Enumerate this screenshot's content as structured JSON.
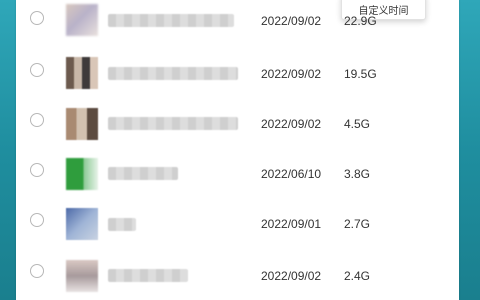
{
  "popup": {
    "label": "自定义时间"
  },
  "rows": [
    {
      "date": "2022/09/02",
      "size": "22.9G"
    },
    {
      "date": "2022/09/02",
      "size": "19.5G"
    },
    {
      "date": "2022/09/02",
      "size": "4.5G"
    },
    {
      "date": "2022/06/10",
      "size": "3.8G"
    },
    {
      "date": "2022/09/01",
      "size": "2.7G"
    },
    {
      "date": "2022/09/02",
      "size": "2.4G"
    }
  ]
}
